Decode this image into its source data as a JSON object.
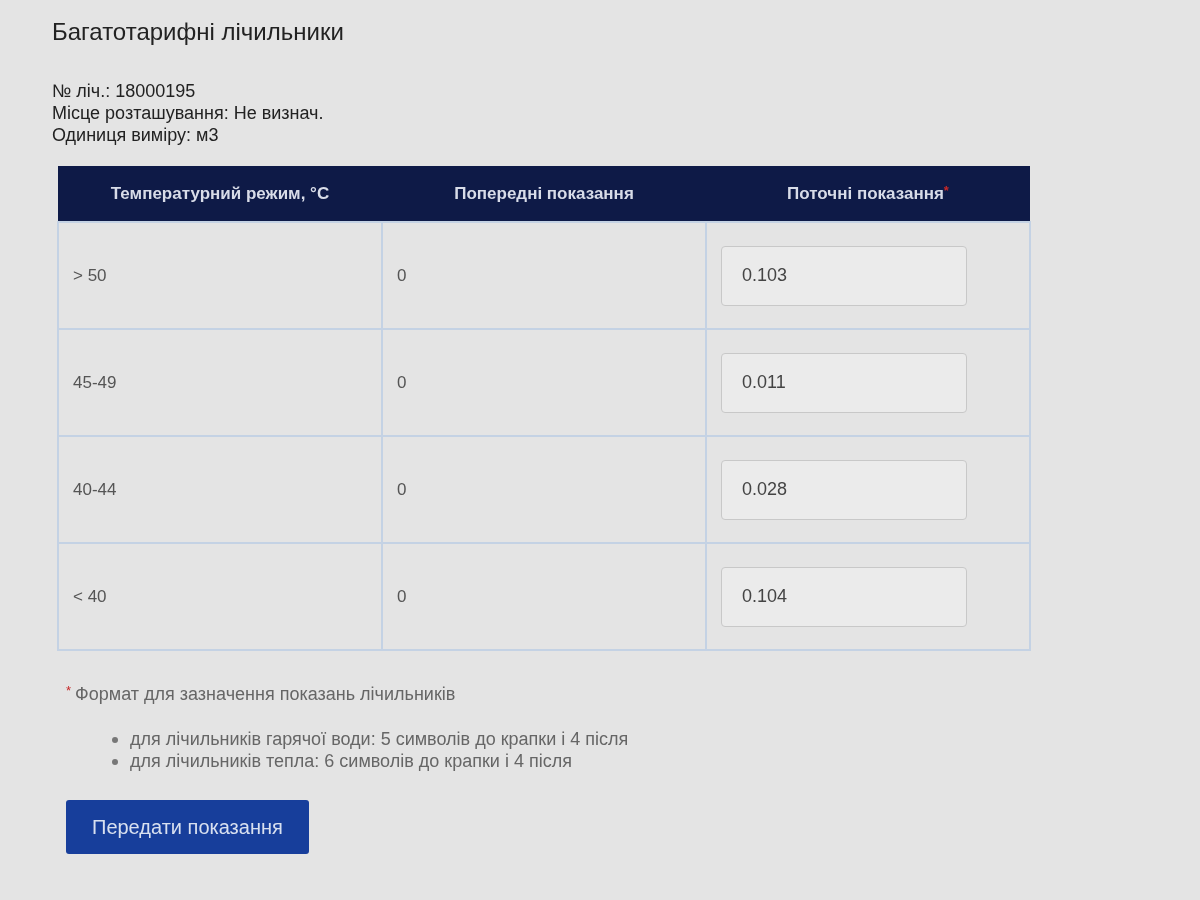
{
  "title": "Багатотарифні лічильники",
  "info": [
    "№ ліч.: 18000195",
    "Місце розташування: Не визнач.",
    "Одиниця виміру: м3"
  ],
  "table": {
    "columns": [
      {
        "label": "Температурний режим, °C"
      },
      {
        "label": "Попередні показання"
      },
      {
        "label": "Поточні показання",
        "required_mark": "*"
      }
    ],
    "rows": [
      {
        "mode": "> 50",
        "previous": "0",
        "current": "0.103"
      },
      {
        "mode": "45-49",
        "previous": "0",
        "current": "0.011"
      },
      {
        "mode": "40-44",
        "previous": "0",
        "current": "0.028"
      },
      {
        "mode": "< 40",
        "previous": "0",
        "current": "0.104"
      }
    ]
  },
  "note": {
    "mark": "*",
    "text": "Формат для зазначення показань лічильників",
    "items": [
      "для лічильників гарячої води: 5 символів до крапки і 4 після",
      "для лічильників тепла: 6 символів до крапки і 4 після"
    ]
  },
  "submit_button": "Передати показання"
}
